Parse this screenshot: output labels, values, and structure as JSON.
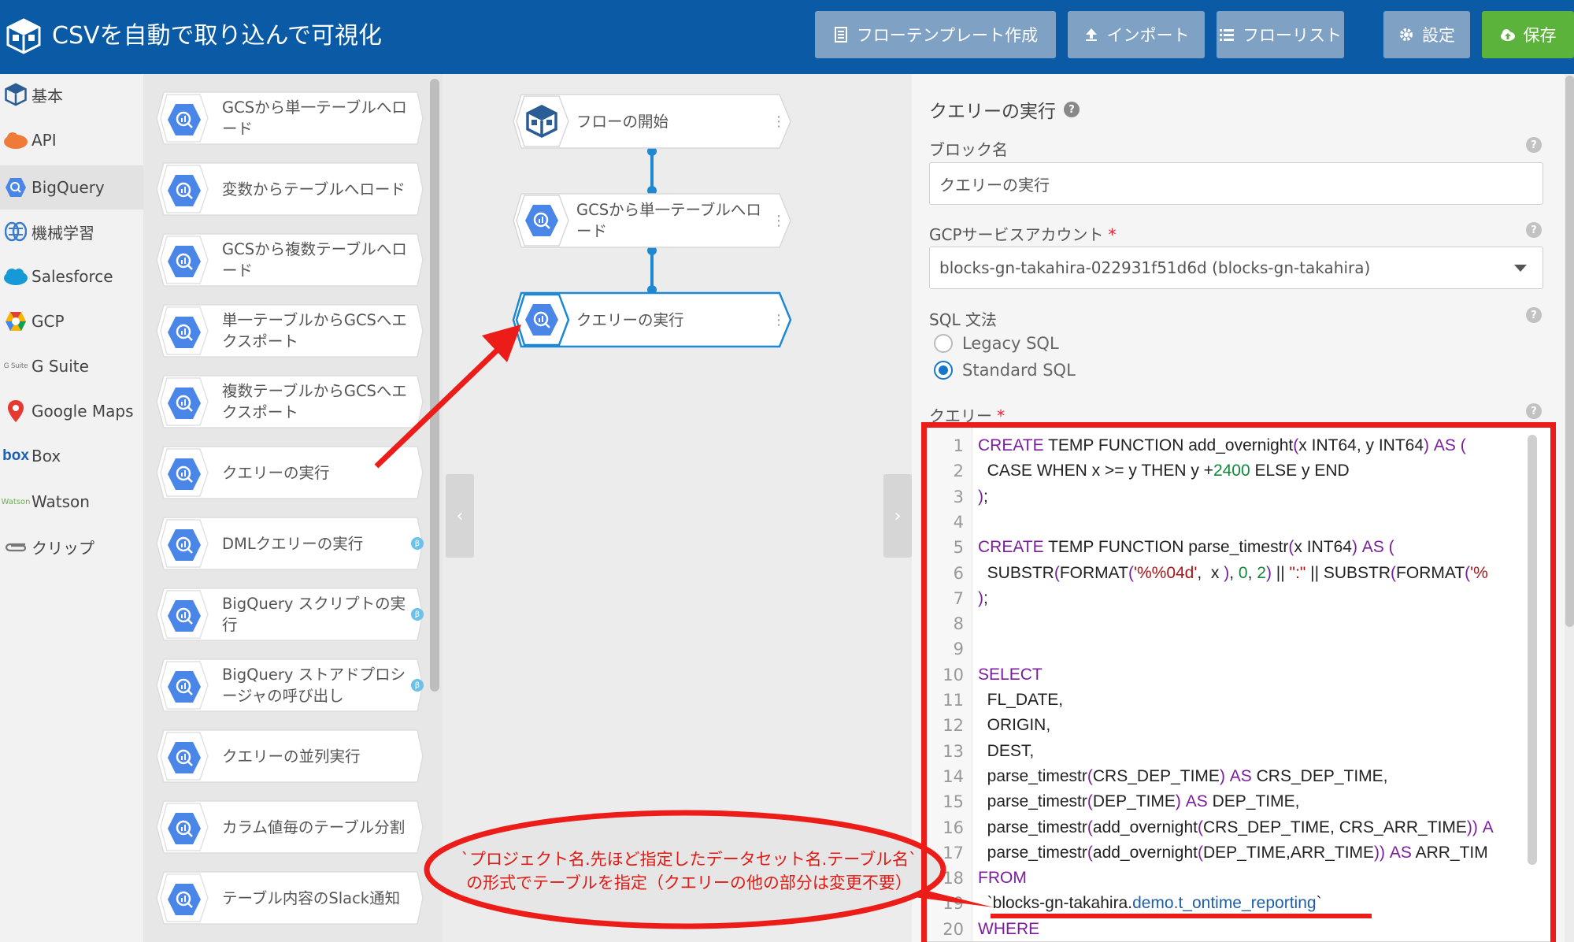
{
  "header": {
    "title": "CSVを自動で取り込んで可視化",
    "buttons": {
      "template": "フローテンプレート作成",
      "import": "インポート",
      "flowlist": "フローリスト",
      "settings": "設定",
      "save": "保存"
    }
  },
  "categories": [
    {
      "label": "基本",
      "icon": "blocks-logo-icon"
    },
    {
      "label": "API",
      "icon": "api-icon"
    },
    {
      "label": "BigQuery",
      "icon": "bigquery-icon"
    },
    {
      "label": "機械学習",
      "icon": "brain-icon"
    },
    {
      "label": "Salesforce",
      "icon": "salesforce-cloud-icon"
    },
    {
      "label": "GCP",
      "icon": "gcp-icon"
    },
    {
      "label": "G Suite",
      "icon": "gsuite-icon",
      "badge": "G Suite"
    },
    {
      "label": "Google Maps",
      "icon": "map-pin-icon"
    },
    {
      "label": "Box",
      "icon": "box-icon",
      "badge": "box"
    },
    {
      "label": "Watson",
      "icon": "watson-icon",
      "badge": "Watson"
    },
    {
      "label": "クリップ",
      "icon": "paperclip-icon"
    }
  ],
  "palette": [
    {
      "label": "GCSから単一テーブルへロード",
      "beta": false
    },
    {
      "label": "変数からテーブルへロード",
      "beta": false
    },
    {
      "label": "GCSから複数テーブルへロード",
      "beta": false
    },
    {
      "label": "単一テーブルからGCSへエクスポート",
      "beta": false
    },
    {
      "label": "複数テーブルからGCSへエクスポート",
      "beta": false
    },
    {
      "label": "クエリーの実行",
      "beta": false
    },
    {
      "label": "DMLクエリーの実行",
      "beta": true
    },
    {
      "label": "BigQuery スクリプトの実行",
      "beta": true
    },
    {
      "label": "BigQuery ストアドプロシージャの呼び出し",
      "beta": true
    },
    {
      "label": "クエリーの並列実行",
      "beta": false
    },
    {
      "label": "カラム値毎のテーブル分割",
      "beta": false
    },
    {
      "label": "テーブル内容のSlack通知",
      "beta": false
    }
  ],
  "beta_mark": "β",
  "flow": {
    "nodes": [
      {
        "label": "フローの開始",
        "icon": "blocks-logo-icon"
      },
      {
        "label": "GCSから単一テーブルへロード",
        "icon": "bigquery-icon"
      },
      {
        "label": "クエリーの実行",
        "icon": "bigquery-icon"
      }
    ],
    "collapse_left": "‹",
    "collapse_right": "›",
    "kebab": "⋮"
  },
  "properties": {
    "title": "クエリーの実行",
    "block_name_label": "ブロック名",
    "block_name_value": "クエリーの実行",
    "service_account_label": "GCPサービスアカウント",
    "service_account_value": "blocks-gn-takahira-022931f51d6d (blocks-gn-takahira)",
    "sql_dialect_label": "SQL 文法",
    "dialect_options": [
      "Legacy SQL",
      "Standard SQL"
    ],
    "dialect_selected": "Standard SQL",
    "query_label": "クエリー",
    "required_mark": "*",
    "help_mark": "?"
  },
  "query_lines": [
    {
      "n": "1",
      "parts": [
        [
          "kw",
          "CREATE"
        ],
        [
          "t",
          " TEMP FUNCTION add_overnight"
        ],
        [
          "kw",
          "("
        ],
        [
          "t",
          "x INT64, y INT64"
        ],
        [
          "kw",
          ")"
        ],
        [
          "t",
          " "
        ],
        [
          "kw",
          "AS ("
        ]
      ]
    },
    {
      "n": "2",
      "parts": [
        [
          "t",
          "  CASE WHEN x >= y THEN y +"
        ],
        [
          "num",
          "2400"
        ],
        [
          "t",
          " ELSE y END"
        ]
      ]
    },
    {
      "n": "3",
      "parts": [
        [
          "kw",
          ")"
        ],
        [
          "t",
          ";"
        ]
      ]
    },
    {
      "n": "4",
      "parts": []
    },
    {
      "n": "5",
      "parts": [
        [
          "kw",
          "CREATE"
        ],
        [
          "t",
          " TEMP FUNCTION parse_timestr"
        ],
        [
          "kw",
          "("
        ],
        [
          "t",
          "x INT64"
        ],
        [
          "kw",
          ")"
        ],
        [
          "t",
          " "
        ],
        [
          "kw",
          "AS ("
        ]
      ]
    },
    {
      "n": "6",
      "parts": [
        [
          "t",
          "  SUBSTR"
        ],
        [
          "kw",
          "("
        ],
        [
          "t",
          "FORMAT"
        ],
        [
          "kw",
          "("
        ],
        [
          "str",
          "'%%04d'"
        ],
        [
          "t",
          ",  x "
        ],
        [
          "kw",
          ")"
        ],
        [
          "t",
          ", "
        ],
        [
          "num",
          "0"
        ],
        [
          "t",
          ", "
        ],
        [
          "num",
          "2"
        ],
        [
          "kw",
          ")"
        ],
        [
          "t",
          " || "
        ],
        [
          "str",
          "\":\""
        ],
        [
          "t",
          " || SUBSTR"
        ],
        [
          "kw",
          "("
        ],
        [
          "t",
          "FORMAT"
        ],
        [
          "kw",
          "("
        ],
        [
          "str",
          "'%"
        ]
      ]
    },
    {
      "n": "7",
      "parts": [
        [
          "kw",
          ")"
        ],
        [
          "t",
          ";"
        ]
      ]
    },
    {
      "n": "8",
      "parts": []
    },
    {
      "n": "9",
      "parts": []
    },
    {
      "n": "10",
      "parts": [
        [
          "kw",
          "SELECT"
        ]
      ]
    },
    {
      "n": "11",
      "parts": [
        [
          "t",
          "  FL_DATE,"
        ]
      ]
    },
    {
      "n": "12",
      "parts": [
        [
          "t",
          "  ORIGIN,"
        ]
      ]
    },
    {
      "n": "13",
      "parts": [
        [
          "t",
          "  DEST,"
        ]
      ]
    },
    {
      "n": "14",
      "parts": [
        [
          "t",
          "  parse_timestr"
        ],
        [
          "kw",
          "("
        ],
        [
          "t",
          "CRS_DEP_TIME"
        ],
        [
          "kw",
          ")"
        ],
        [
          "t",
          " "
        ],
        [
          "kw",
          "AS"
        ],
        [
          "t",
          " CRS_DEP_TIME,"
        ]
      ]
    },
    {
      "n": "15",
      "parts": [
        [
          "t",
          "  parse_timestr"
        ],
        [
          "kw",
          "("
        ],
        [
          "t",
          "DEP_TIME"
        ],
        [
          "kw",
          ")"
        ],
        [
          "t",
          " "
        ],
        [
          "kw",
          "AS"
        ],
        [
          "t",
          " DEP_TIME,"
        ]
      ]
    },
    {
      "n": "16",
      "parts": [
        [
          "t",
          "  parse_timestr"
        ],
        [
          "kw",
          "("
        ],
        [
          "t",
          "add_overnight"
        ],
        [
          "kw",
          "("
        ],
        [
          "t",
          "CRS_DEP_TIME, CRS_ARR_TIME"
        ],
        [
          "kw",
          "))"
        ],
        [
          "t",
          " "
        ],
        [
          "kw",
          "A"
        ]
      ]
    },
    {
      "n": "17",
      "parts": [
        [
          "t",
          "  parse_timestr"
        ],
        [
          "kw",
          "("
        ],
        [
          "t",
          "add_overnight"
        ],
        [
          "kw",
          "("
        ],
        [
          "t",
          "DEP_TIME,ARR_TIME"
        ],
        [
          "kw",
          "))"
        ],
        [
          "t",
          " "
        ],
        [
          "kw",
          "AS"
        ],
        [
          "t",
          " ARR_TIM"
        ]
      ]
    },
    {
      "n": "18",
      "parts": [
        [
          "kw",
          "FROM"
        ]
      ]
    },
    {
      "n": "19",
      "parts": [
        [
          "t",
          "  `blocks-gn-takahira."
        ],
        [
          "tbl",
          "demo.t_ontime_reporting"
        ],
        [
          "t",
          "`"
        ]
      ]
    },
    {
      "n": "20",
      "parts": [
        [
          "kw",
          "WHERE"
        ]
      ]
    }
  ],
  "annotation": {
    "line1": "`プロジェクト名.先ほど指定したデータセット名.テーブル名`",
    "line2": "の形式でテーブルを指定（クエリーの他の部分は変更不要）",
    "color": "#ec1c18"
  }
}
